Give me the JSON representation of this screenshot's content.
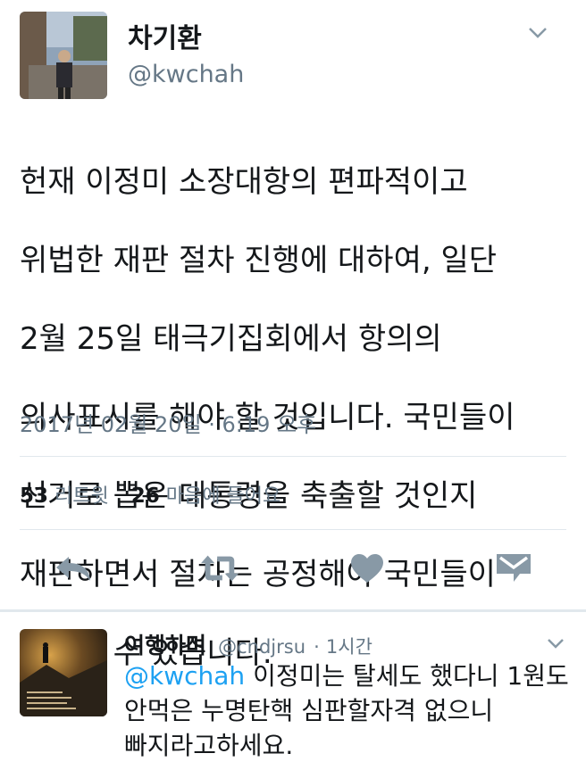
{
  "tweet": {
    "author_name": "차기환",
    "author_handle": "@kwchah",
    "text_lines": [
      "헌재 이정미 소장대항의 편파적이고",
      "위법한 재판 절차 진행에 대하여, 일단",
      "2월 25일 태극기집회에서 항의의",
      "의사표시를 해야 할 것입니다. 국민들이",
      "선거로 뽑은 대통령을 축출할 것인지",
      "재판하면서 절차는 공정해야 국민들이",
      "수긍할 수 있습니다."
    ],
    "timestamp": "2017년 02월 20일 · 6:19 오후",
    "retweet_count": "53",
    "retweet_label": "리트윗",
    "like_count": "26",
    "like_label": "마음에 들어요",
    "actions": [
      "reply-icon",
      "retweet-icon",
      "heart-icon",
      "direct-message-icon"
    ]
  },
  "reply": {
    "author_name": "여행하며",
    "author_handle": "@cndjrsu",
    "time_ago": "1시간",
    "meta_separator": "·",
    "mention": "@kwchah",
    "text_after_mention": " 이정미는 탈세도 했다니 1원도",
    "text_line2": "안먹은 누명탄핵 심판할자격 없으니",
    "text_line3": "빠지라고하세요."
  },
  "colors": {
    "text": "#14171a",
    "secondary": "#657786",
    "accent": "#1da1f2",
    "icon": "#8899a6",
    "divider": "#e1e8ed"
  }
}
